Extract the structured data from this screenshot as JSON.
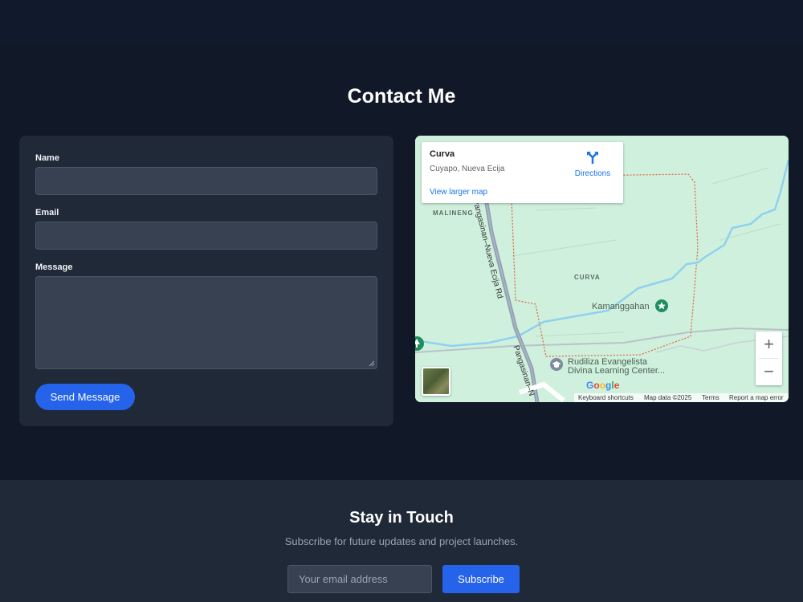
{
  "contact": {
    "title": "Contact Me",
    "form": {
      "name_label": "Name",
      "email_label": "Email",
      "message_label": "Message",
      "name_value": "",
      "email_value": "",
      "message_value": "",
      "submit_label": "Send Message"
    }
  },
  "map": {
    "place_name": "Curva",
    "place_address": "Cuyapo, Nueva Ecija",
    "directions_label": "Directions",
    "view_larger_label": "View larger map",
    "labels": {
      "malineng": "MALINENG",
      "curva": "CURVA",
      "road_north": "Pangasinan–Nueva Ecija Rd",
      "road_south": "Pangasinan–N",
      "kamanggahan": "Kamanggahan",
      "school_line1": "Rudiliza Evangelista",
      "school_line2": "Divina Learning Center..."
    },
    "google": "Google",
    "attribution": {
      "keyboard": "Keyboard shortcuts",
      "map_data": "Map data ©2025",
      "terms": "Terms",
      "report": "Report a map error"
    },
    "zoom_in": "+",
    "zoom_out": "−",
    "colors": {
      "land": "#cff0dd",
      "water": "#8fd1ef",
      "boundary": "#e0603f",
      "road": "#8e9cb0",
      "link": "#1a73e8"
    }
  },
  "newsletter": {
    "title": "Stay in Touch",
    "subtitle": "Subscribe for future updates and project launches.",
    "email_placeholder": "Your email address",
    "email_value": "",
    "submit_label": "Subscribe"
  },
  "colors": {
    "page_bg": "#111827",
    "card_bg": "#1f2937",
    "accent": "#2563eb"
  }
}
